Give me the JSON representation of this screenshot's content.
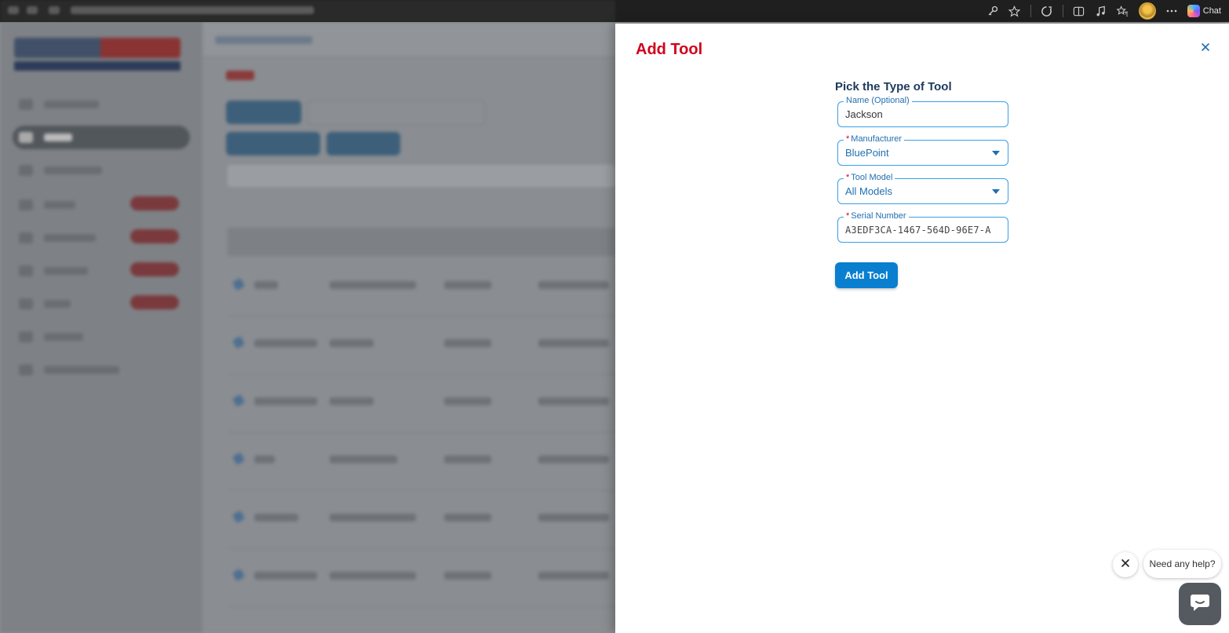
{
  "browser": {
    "chat_label": "Chat",
    "toolbar_icons": [
      "key-icon",
      "star-outline-icon",
      "extensions-icon",
      "split-screen-icon",
      "music-icon",
      "favorites-icon",
      "profile-avatar",
      "more-icon",
      "copilot-icon"
    ]
  },
  "drawer": {
    "title": "Add Tool",
    "close_icon": "close-icon",
    "heading": "Pick the Type of Tool",
    "fields": {
      "name": {
        "label": "Name (Optional)",
        "value": "Jackson",
        "required": false
      },
      "manufacturer": {
        "label": "Manufacturer",
        "value": "BluePoint",
        "required": true
      },
      "tool_model": {
        "label": "Tool Model",
        "value": "All Models",
        "required": true
      },
      "serial_number": {
        "label": "Serial Number",
        "value": "A3EDF3CA-1467-564D-96E7-A",
        "required": true
      }
    },
    "required_marker": "*",
    "submit_label": "Add Tool"
  },
  "help_widget": {
    "prompt": "Need any help?",
    "close_icon": "close-icon",
    "launcher_icon": "chat-bubble-icon"
  },
  "colors": {
    "title_red": "#d0021b",
    "accent_blue": "#0a7fd0",
    "field_border": "#3a9ee4",
    "heading_navy": "#1d3a5c"
  }
}
